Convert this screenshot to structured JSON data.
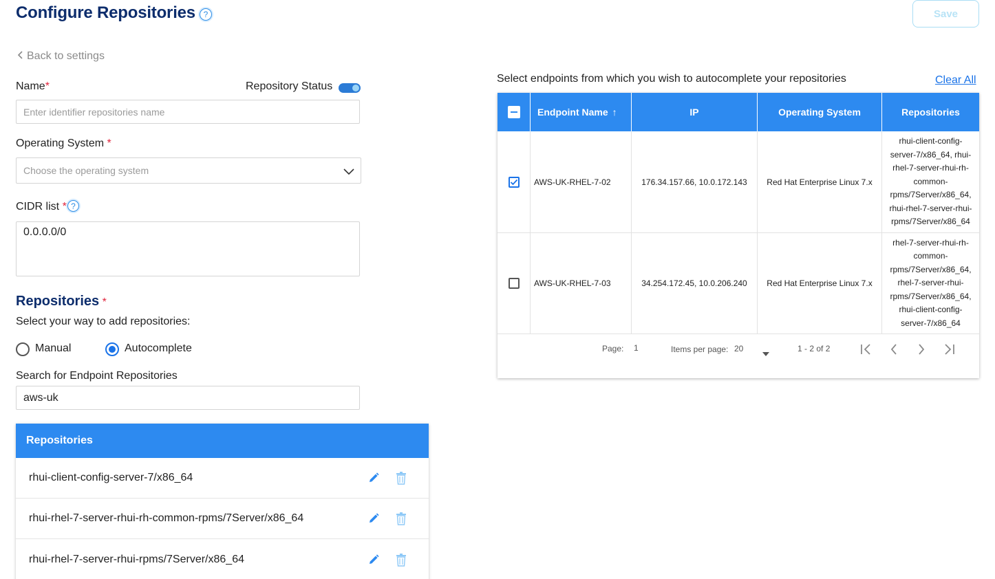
{
  "header": {
    "title": "Configure Repositories",
    "help_glyph": "?",
    "save_label": "Save"
  },
  "back_link": {
    "label": "Back to settings",
    "icon": "chevron-left-icon"
  },
  "form": {
    "name_label": "Name",
    "required_mark": "*",
    "status_label": "Repository Status",
    "status_enabled": true,
    "name_placeholder": "Enter identifier repositories name",
    "os_label": "Operating System",
    "os_placeholder": "Choose the operating system",
    "cidr_label": "CIDR list",
    "cidr_value": "0.0.0.0/0",
    "repositories_title": "Repositories",
    "add_way_label": "Select your way to add repositories:",
    "radio_manual": "Manual",
    "radio_autocomplete": "Autocomplete",
    "selected_mode": "Autocomplete",
    "search_label": "Search for Endpoint Repositories",
    "search_value": "aws-uk"
  },
  "repo_panel": {
    "header": "Repositories",
    "items": [
      "rhui-client-config-server-7/x86_64",
      "rhui-rhel-7-server-rhui-rh-common-rpms/7Server/x86_64",
      "rhui-rhel-7-server-rhui-rpms/7Server/x86_64"
    ]
  },
  "endpoints": {
    "title": "Select endpoints from which you wish to autocomplete your repositories",
    "clear_all": "Clear All",
    "columns": [
      "Endpoint Name",
      "IP",
      "Operating System",
      "Repositories"
    ],
    "sort_glyph": "↑",
    "rows": [
      {
        "checked": true,
        "name": "AWS-UK-RHEL-7-02",
        "ip": "176.34.157.66, 10.0.172.143",
        "os": "Red Hat Enterprise Linux 7.x",
        "repos": [
          "rhui-client-config-",
          "server-7/x86_64, rhui-",
          "rhel-7-server-rhui-rh-",
          "common-",
          "rpms/7Server/x86_64,",
          "rhui-rhel-7-server-rhui-",
          "rpms/7Server/x86_64"
        ]
      },
      {
        "checked": false,
        "name": "AWS-UK-RHEL-7-03",
        "ip": "34.254.172.45, 10.0.206.240",
        "os": "Red Hat Enterprise Linux 7.x",
        "repos": [
          "rhel-7-server-rhui-rh-",
          "common-",
          "rpms/7Server/x86_64,",
          "rhel-7-server-rhui-",
          "rpms/7Server/x86_64,",
          "rhui-client-config-",
          "server-7/x86_64"
        ]
      }
    ],
    "pager": {
      "page_label": "Page:",
      "page_value": "1",
      "items_label": "Items per page:",
      "items_value": "20",
      "range": "1 - 2 of 2"
    }
  },
  "colors": {
    "brand_navy": "#0d2d6c",
    "accent_blue": "#2d8af0",
    "link_blue": "#1a73e8",
    "required_red": "#e0243c"
  }
}
